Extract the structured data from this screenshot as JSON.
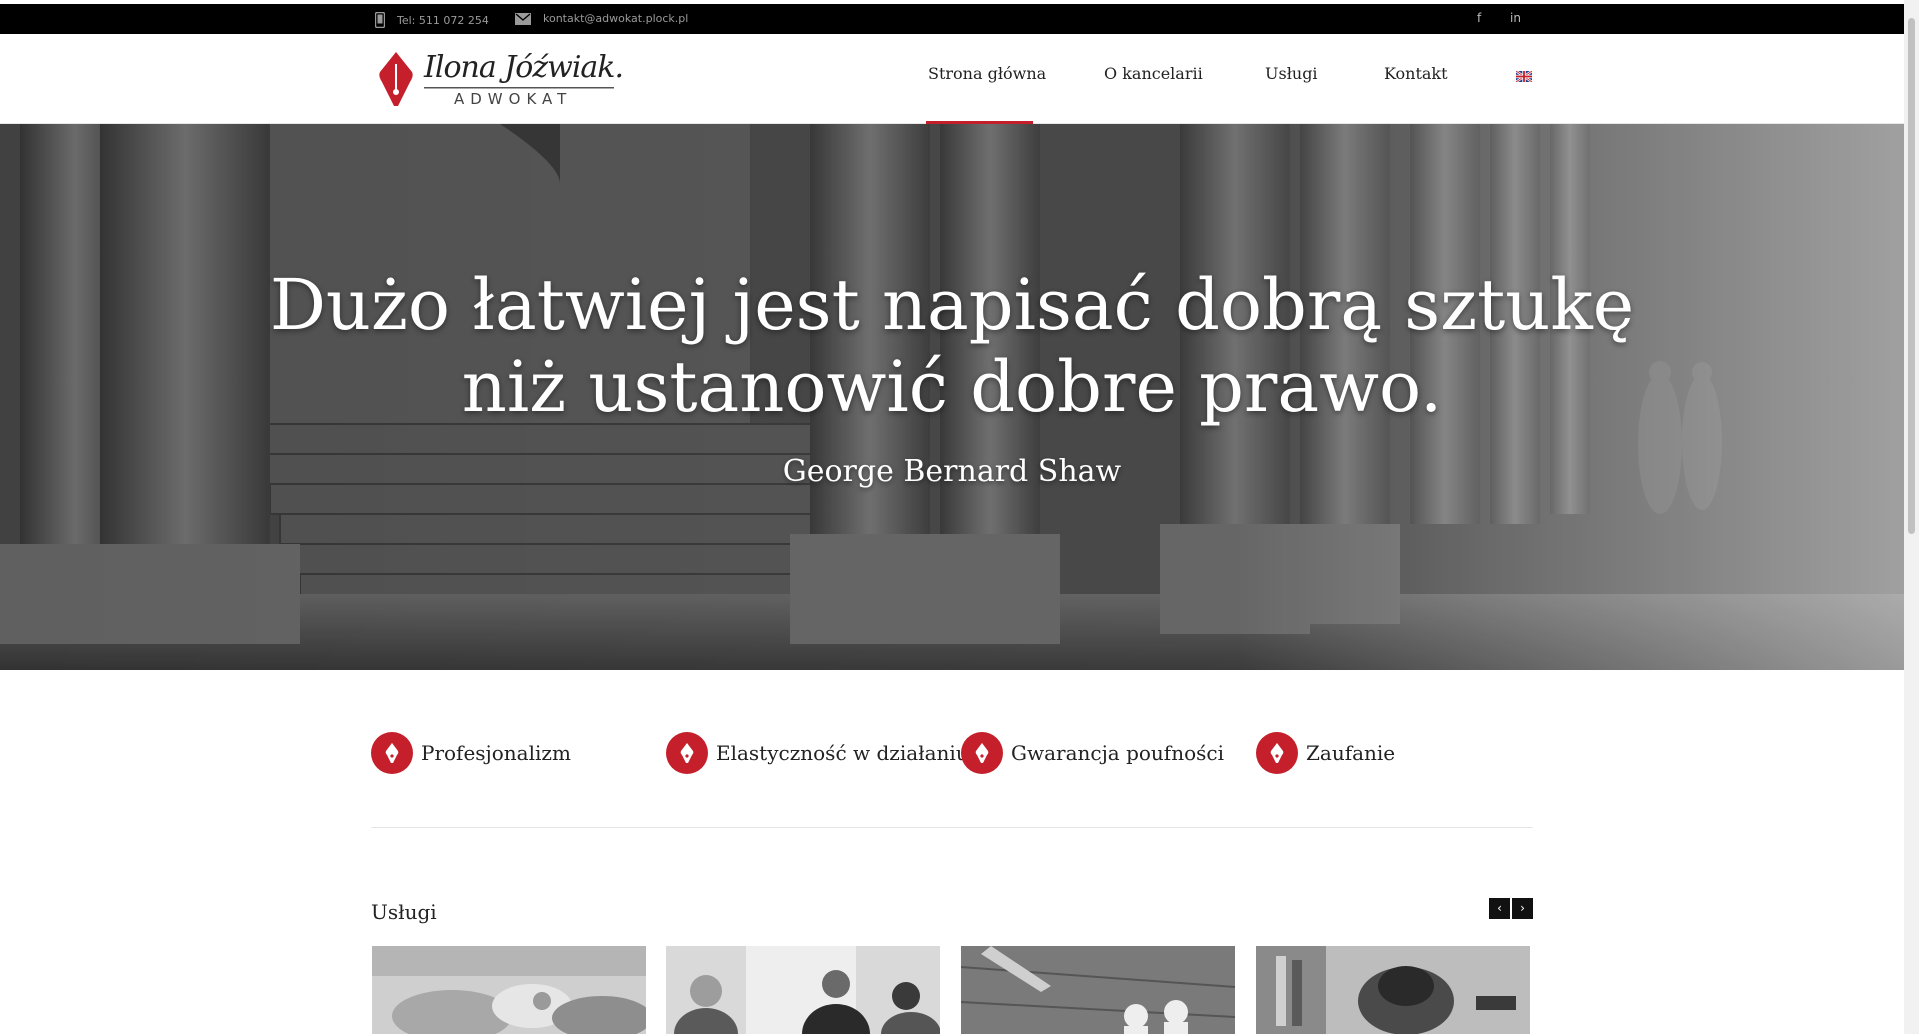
{
  "topbar": {
    "phone": "Tel: 511 072 254",
    "email": "kontakt@adwokat.plock.pl",
    "social": [
      "f",
      "in"
    ],
    "background": "#000000"
  },
  "header": {
    "logo_signature": "Ilona Jóźwiak.",
    "logo_subtitle": "ADWOKAT",
    "nav": [
      {
        "label": "Strona główna",
        "active": true
      },
      {
        "label": "O kancelarii",
        "active": false
      },
      {
        "label": "Usługi",
        "active": false
      },
      {
        "label": "Kontakt",
        "active": false
      }
    ],
    "language_icon": "uk-flag-icon"
  },
  "hero": {
    "quote_line1": "Dużo łatwiej jest napisać dobrą sztukę",
    "quote_line2": "niż ustanowić dobre prawo.",
    "author": "George Bernard Shaw"
  },
  "features": [
    {
      "label": "Profesjonalizm",
      "icon": "pen-nib-icon"
    },
    {
      "label": "Elastyczność w działaniu",
      "icon": "pen-nib-icon"
    },
    {
      "label": "Gwarancja poufności",
      "icon": "pen-nib-icon"
    },
    {
      "label": "Zaufanie",
      "icon": "pen-nib-icon"
    }
  ],
  "services": {
    "title": "Usługi",
    "prev": "‹",
    "next": "›"
  },
  "colors": {
    "accent": "#c41f2b",
    "text": "#222222"
  }
}
